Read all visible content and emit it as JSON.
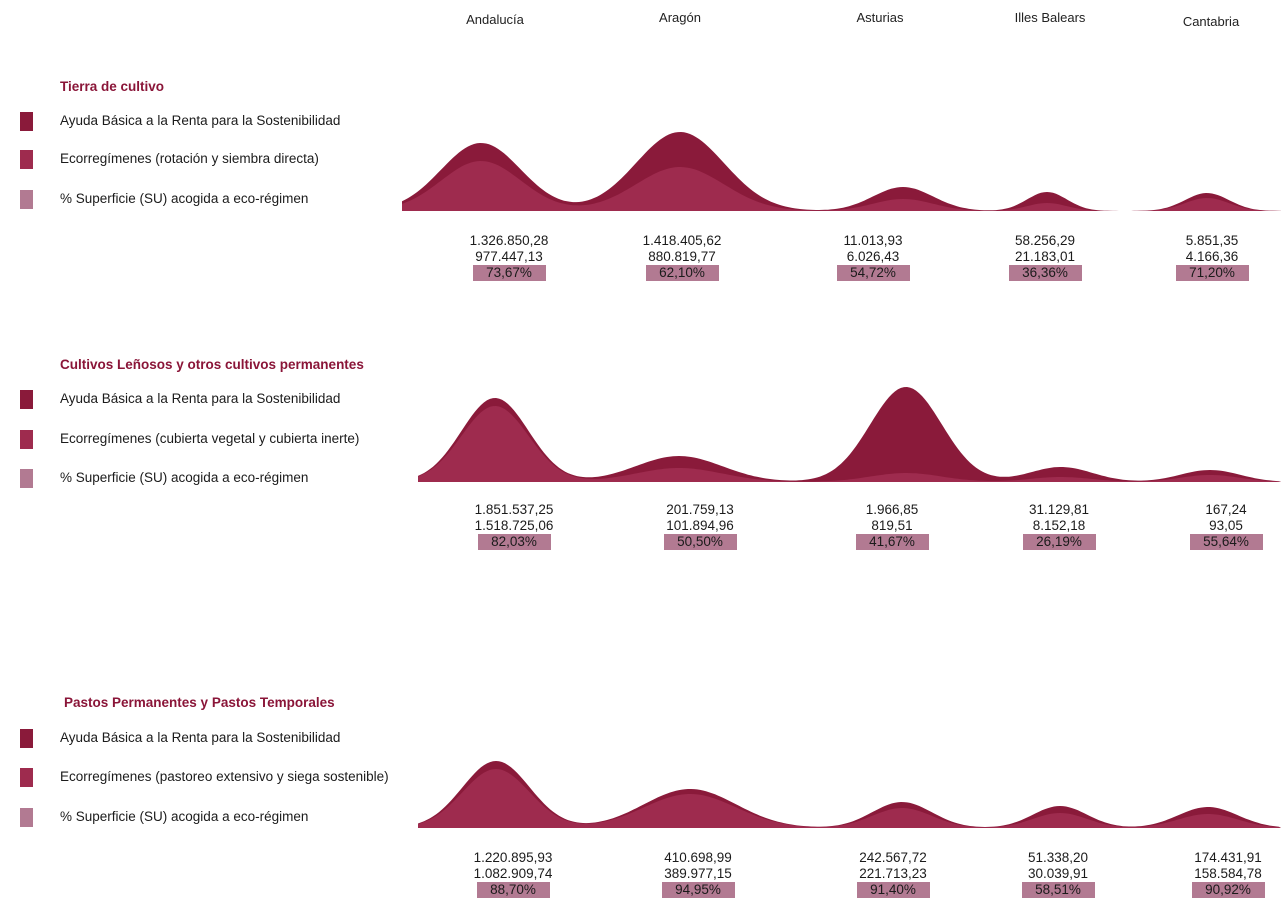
{
  "colors": {
    "title": "#8a1538",
    "ayuda": "#8a1a3a",
    "eco": "#9e2b4e",
    "pct": "#b27a92"
  },
  "regions": [
    "Andalucía",
    "Aragón",
    "Asturias",
    "Illes Balears",
    "Cantabria"
  ],
  "chart_data": [
    {
      "type": "area",
      "title": "Tierra de cultivo",
      "categories": [
        "Andalucía",
        "Aragón",
        "Asturias",
        "Illes Balears",
        "Cantabria"
      ],
      "series": [
        {
          "name": "Ayuda Básica a la Renta para la Sostenibilidad",
          "values": [
            "1.326.850,28",
            "1.418.405,62",
            "11.013,93",
            "58.256,29",
            "5.851,35"
          ],
          "numeric": [
            1326850.28,
            1418405.62,
            11013.93,
            58256.29,
            5851.35
          ]
        },
        {
          "name": "Ecorregímenes (rotación y siembra directa)",
          "values": [
            "977.447,13",
            "880.819,77",
            "6.026,43",
            "21.183,01",
            "4.166,36"
          ],
          "numeric": [
            977447.13,
            880819.77,
            6026.43,
            21183.01,
            4166.36
          ]
        },
        {
          "name": "% Superficie (SU) acogida a eco-régimen",
          "values": [
            "73,67%",
            "62,10%",
            "54,72%",
            "36,36%",
            "71,20%"
          ],
          "numeric": [
            73.67,
            62.1,
            54.72,
            36.36,
            71.2
          ]
        }
      ]
    },
    {
      "type": "area",
      "title": "Cultivos Leñosos y otros cultivos permanentes",
      "categories": [
        "Andalucía",
        "Aragón",
        "Asturias",
        "Illes Balears",
        "Cantabria"
      ],
      "series": [
        {
          "name": "Ayuda Básica a la Renta para la Sostenibilidad",
          "values": [
            "1.851.537,25",
            "201.759,13",
            "1.966,85",
            "31.129,81",
            "167,24"
          ],
          "numeric": [
            1851537.25,
            201759.13,
            1966.85,
            31129.81,
            167.24
          ]
        },
        {
          "name": "Ecorregímenes (cubierta vegetal y cubierta inerte)",
          "values": [
            "1.518.725,06",
            "101.894,96",
            "819,51",
            "8.152,18",
            "93,05"
          ],
          "numeric": [
            1518725.06,
            101894.96,
            819.51,
            8152.18,
            93.05
          ]
        },
        {
          "name": "% Superficie (SU) acogida a eco-régimen",
          "values": [
            "82,03%",
            "50,50%",
            "41,67%",
            "26,19%",
            "55,64%"
          ],
          "numeric": [
            82.03,
            50.5,
            41.67,
            26.19,
            55.64
          ]
        }
      ]
    },
    {
      "type": "area",
      "title": "Pastos Permanentes y Pastos Temporales",
      "categories": [
        "Andalucía",
        "Aragón",
        "Asturias",
        "Illes Balears",
        "Cantabria"
      ],
      "series": [
        {
          "name": "Ayuda Básica a la Renta para la Sostenibilidad",
          "values": [
            "1.220.895,93",
            "410.698,99",
            "242.567,72",
            "51.338,20",
            "174.431,91"
          ],
          "numeric": [
            1220895.93,
            410698.99,
            242567.72,
            51338.2,
            174431.91
          ]
        },
        {
          "name": "Ecorregímenes (pastoreo extensivo y siega sostenible)",
          "values": [
            "1.082.909,74",
            "389.977,15",
            "221.713,23",
            "30.039,91",
            "158.584,78"
          ],
          "numeric": [
            1082909.74,
            389977.15,
            221713.23,
            30039.91,
            158584.78
          ]
        },
        {
          "name": "% Superficie (SU) acogida a eco-régimen",
          "values": [
            "88,70%",
            "94,95%",
            "91,40%",
            "58,51%",
            "90,92%"
          ],
          "numeric": [
            88.7,
            94.95,
            91.4,
            58.51,
            90.92
          ]
        }
      ]
    }
  ]
}
